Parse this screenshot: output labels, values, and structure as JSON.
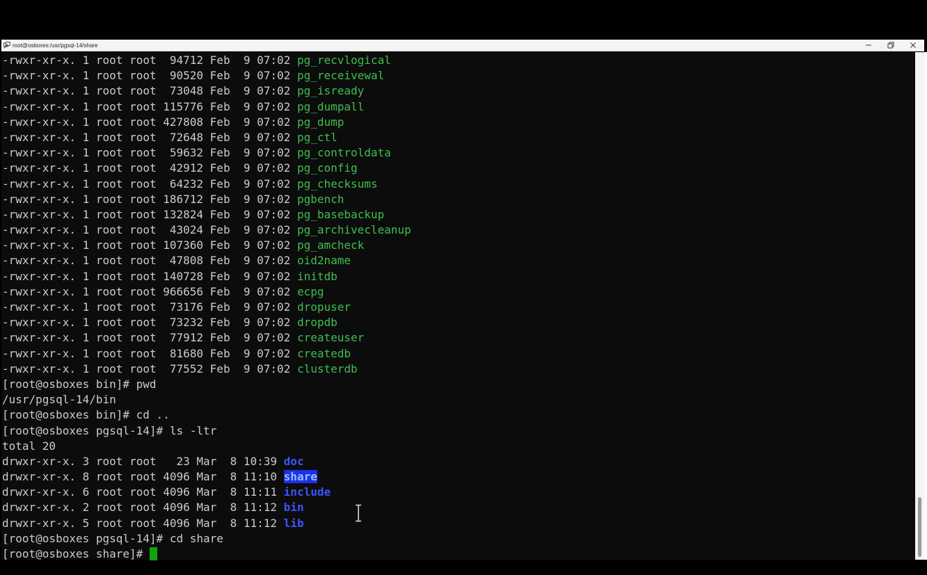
{
  "window": {
    "title": "root@osboxes:/usr/pgsql-14/share",
    "icons": {
      "app": "putty-icon",
      "minimize": "minimize-icon",
      "maximize": "maximize-icon",
      "close": "close-icon"
    }
  },
  "colors": {
    "terminal_bg": "#0c0c0c",
    "text": "#cccccc",
    "executable": "#3fbf4f",
    "directory": "#3b54ff",
    "highlight_bg": "#1f2fe8",
    "cursor": "#13a10e"
  },
  "listing1": [
    {
      "perms": "-rwxr-xr-x.",
      "links": "1",
      "owner": "root",
      "group": "root",
      "size": "94712",
      "month": "Feb",
      "day": "9",
      "time": "07:02",
      "name": "pg_recvlogical"
    },
    {
      "perms": "-rwxr-xr-x.",
      "links": "1",
      "owner": "root",
      "group": "root",
      "size": "90520",
      "month": "Feb",
      "day": "9",
      "time": "07:02",
      "name": "pg_receivewal"
    },
    {
      "perms": "-rwxr-xr-x.",
      "links": "1",
      "owner": "root",
      "group": "root",
      "size": "73048",
      "month": "Feb",
      "day": "9",
      "time": "07:02",
      "name": "pg_isready"
    },
    {
      "perms": "-rwxr-xr-x.",
      "links": "1",
      "owner": "root",
      "group": "root",
      "size": "115776",
      "month": "Feb",
      "day": "9",
      "time": "07:02",
      "name": "pg_dumpall"
    },
    {
      "perms": "-rwxr-xr-x.",
      "links": "1",
      "owner": "root",
      "group": "root",
      "size": "427808",
      "month": "Feb",
      "day": "9",
      "time": "07:02",
      "name": "pg_dump"
    },
    {
      "perms": "-rwxr-xr-x.",
      "links": "1",
      "owner": "root",
      "group": "root",
      "size": "72648",
      "month": "Feb",
      "day": "9",
      "time": "07:02",
      "name": "pg_ctl"
    },
    {
      "perms": "-rwxr-xr-x.",
      "links": "1",
      "owner": "root",
      "group": "root",
      "size": "59632",
      "month": "Feb",
      "day": "9",
      "time": "07:02",
      "name": "pg_controldata"
    },
    {
      "perms": "-rwxr-xr-x.",
      "links": "1",
      "owner": "root",
      "group": "root",
      "size": "42912",
      "month": "Feb",
      "day": "9",
      "time": "07:02",
      "name": "pg_config"
    },
    {
      "perms": "-rwxr-xr-x.",
      "links": "1",
      "owner": "root",
      "group": "root",
      "size": "64232",
      "month": "Feb",
      "day": "9",
      "time": "07:02",
      "name": "pg_checksums"
    },
    {
      "perms": "-rwxr-xr-x.",
      "links": "1",
      "owner": "root",
      "group": "root",
      "size": "186712",
      "month": "Feb",
      "day": "9",
      "time": "07:02",
      "name": "pgbench"
    },
    {
      "perms": "-rwxr-xr-x.",
      "links": "1",
      "owner": "root",
      "group": "root",
      "size": "132824",
      "month": "Feb",
      "day": "9",
      "time": "07:02",
      "name": "pg_basebackup"
    },
    {
      "perms": "-rwxr-xr-x.",
      "links": "1",
      "owner": "root",
      "group": "root",
      "size": "43024",
      "month": "Feb",
      "day": "9",
      "time": "07:02",
      "name": "pg_archivecleanup"
    },
    {
      "perms": "-rwxr-xr-x.",
      "links": "1",
      "owner": "root",
      "group": "root",
      "size": "107360",
      "month": "Feb",
      "day": "9",
      "time": "07:02",
      "name": "pg_amcheck"
    },
    {
      "perms": "-rwxr-xr-x.",
      "links": "1",
      "owner": "root",
      "group": "root",
      "size": "47808",
      "month": "Feb",
      "day": "9",
      "time": "07:02",
      "name": "oid2name"
    },
    {
      "perms": "-rwxr-xr-x.",
      "links": "1",
      "owner": "root",
      "group": "root",
      "size": "140728",
      "month": "Feb",
      "day": "9",
      "time": "07:02",
      "name": "initdb"
    },
    {
      "perms": "-rwxr-xr-x.",
      "links": "1",
      "owner": "root",
      "group": "root",
      "size": "966656",
      "month": "Feb",
      "day": "9",
      "time": "07:02",
      "name": "ecpg"
    },
    {
      "perms": "-rwxr-xr-x.",
      "links": "1",
      "owner": "root",
      "group": "root",
      "size": "73176",
      "month": "Feb",
      "day": "9",
      "time": "07:02",
      "name": "dropuser"
    },
    {
      "perms": "-rwxr-xr-x.",
      "links": "1",
      "owner": "root",
      "group": "root",
      "size": "73232",
      "month": "Feb",
      "day": "9",
      "time": "07:02",
      "name": "dropdb"
    },
    {
      "perms": "-rwxr-xr-x.",
      "links": "1",
      "owner": "root",
      "group": "root",
      "size": "77912",
      "month": "Feb",
      "day": "9",
      "time": "07:02",
      "name": "createuser"
    },
    {
      "perms": "-rwxr-xr-x.",
      "links": "1",
      "owner": "root",
      "group": "root",
      "size": "81680",
      "month": "Feb",
      "day": "9",
      "time": "07:02",
      "name": "createdb"
    },
    {
      "perms": "-rwxr-xr-x.",
      "links": "1",
      "owner": "root",
      "group": "root",
      "size": "77552",
      "month": "Feb",
      "day": "9",
      "time": "07:02",
      "name": "clusterdb"
    }
  ],
  "session1": [
    "[root@osboxes bin]# pwd",
    "/usr/pgsql-14/bin",
    "[root@osboxes bin]# cd ..",
    "[root@osboxes pgsql-14]# ls -ltr",
    "total 20"
  ],
  "listing2": [
    {
      "perms": "drwxr-xr-x.",
      "links": "3",
      "owner": "root",
      "group": "root",
      "size": "23",
      "month": "Mar",
      "day": "8",
      "time": "10:39",
      "name": "doc",
      "highlight": false
    },
    {
      "perms": "drwxr-xr-x.",
      "links": "8",
      "owner": "root",
      "group": "root",
      "size": "4096",
      "month": "Mar",
      "day": "8",
      "time": "11:10",
      "name": "share",
      "highlight": true
    },
    {
      "perms": "drwxr-xr-x.",
      "links": "6",
      "owner": "root",
      "group": "root",
      "size": "4096",
      "month": "Mar",
      "day": "8",
      "time": "11:11",
      "name": "include",
      "highlight": false
    },
    {
      "perms": "drwxr-xr-x.",
      "links": "2",
      "owner": "root",
      "group": "root",
      "size": "4096",
      "month": "Mar",
      "day": "8",
      "time": "11:12",
      "name": "bin",
      "highlight": false
    },
    {
      "perms": "drwxr-xr-x.",
      "links": "5",
      "owner": "root",
      "group": "root",
      "size": "4096",
      "month": "Mar",
      "day": "8",
      "time": "11:12",
      "name": "lib",
      "highlight": false
    }
  ],
  "session2": [
    "[root@osboxes pgsql-14]# cd share"
  ],
  "prompt": "[root@osboxes share]# ",
  "mouse_cursor": "ibeam-cursor-icon"
}
